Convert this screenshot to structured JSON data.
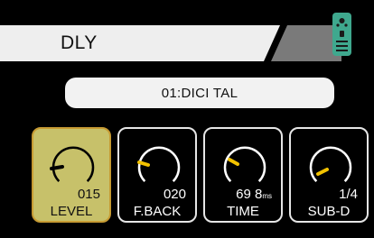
{
  "header": {
    "title": "DLY",
    "device_icon": "remote-pedal-icon",
    "device_color": "#3fa88e"
  },
  "type_selector": {
    "value": "01:DICI TAL"
  },
  "knobs": [
    {
      "label": "LEVEL",
      "value": "015",
      "unit": "",
      "selected": true,
      "pointer_color": "#000000"
    },
    {
      "label": "F.BACK",
      "value": "020",
      "unit": "",
      "selected": false,
      "pointer_color": "#f2c200"
    },
    {
      "label": "TIME",
      "value": "69 8",
      "unit": "ms",
      "selected": false,
      "pointer_color": "#f2c200"
    },
    {
      "label": "SUB-D",
      "value": "1/4",
      "unit": "",
      "selected": false,
      "pointer_color": "#f2c200"
    }
  ],
  "colors": {
    "selected_fill": "#c7c16a",
    "selected_border": "#c79b33",
    "accent": "#f2c200"
  }
}
